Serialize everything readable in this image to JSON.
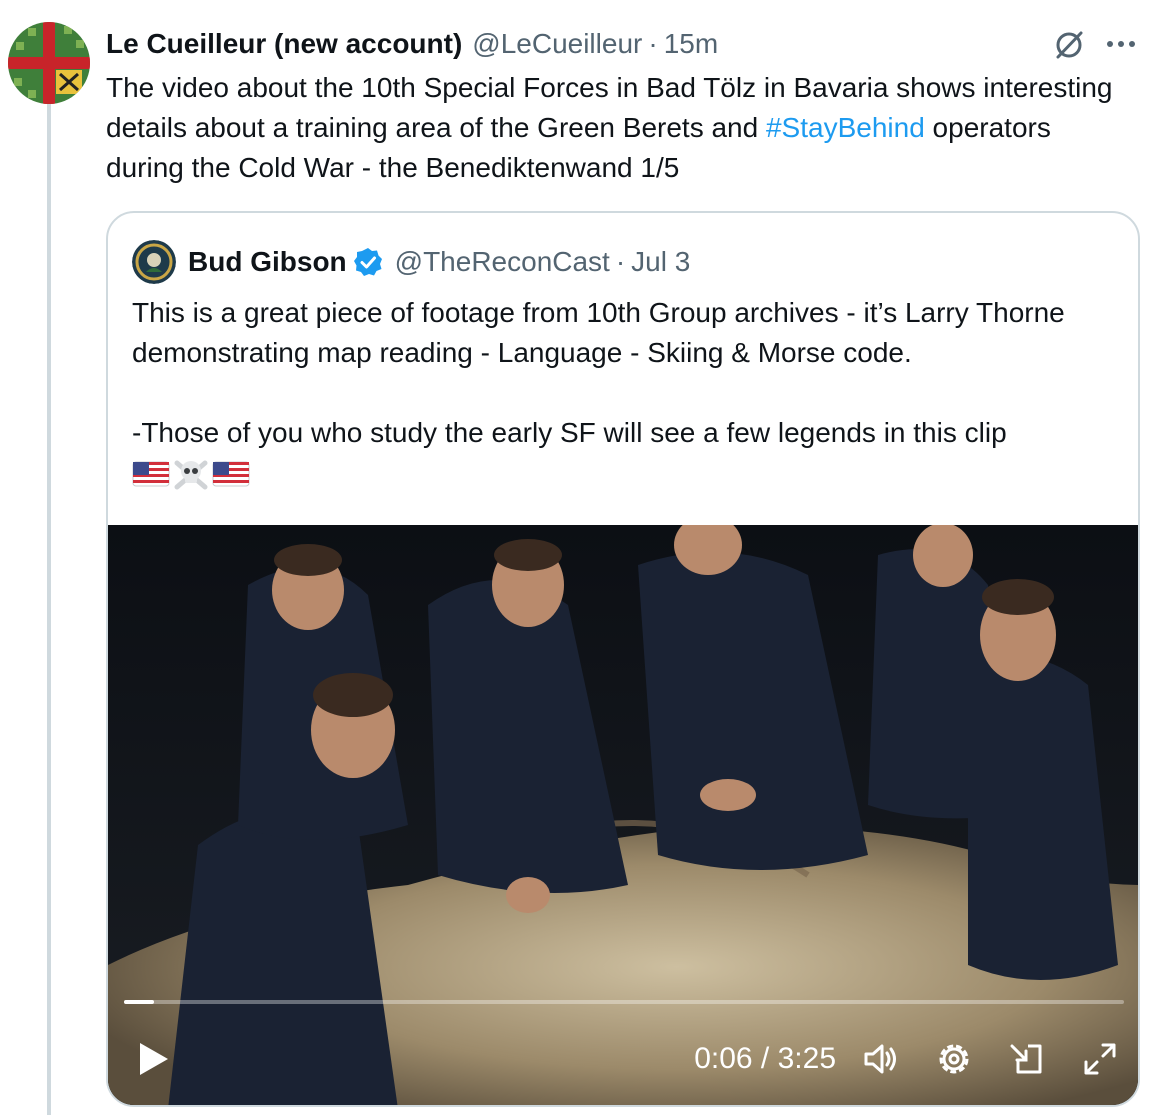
{
  "tweet": {
    "author_name": "Le Cueilleur (new account)",
    "handle": "@LeCueilleur",
    "separator": "·",
    "time": "15m",
    "text_part1": "The video about the 10th Special Forces in Bad Tölz in Bavaria shows interesting details about a training area of the Green Berets and ",
    "hashtag": "#StayBehind",
    "text_part2": " operators during the Cold War - the Benediktenwand 1/5",
    "icons": {
      "grok": "grok-icon",
      "more": "more-icon"
    }
  },
  "quote": {
    "author_name": "Bud Gibson",
    "handle": "@TheReconCast",
    "separator": "·",
    "time": "Jul 3",
    "text": "This is a great piece of footage from 10th Group archives - it’s Larry Thorne demonstrating map reading - Language - Skiing & Morse code.\n\n-Those of you who study the early SF will see a few legends in this clip",
    "emojis": [
      "us-flag",
      "skull-crossbones",
      "us-flag"
    ]
  },
  "video": {
    "current_time": "0:06",
    "duration": "3:25",
    "time_separator": " / ",
    "progress": 0.03,
    "controls": [
      "play-icon",
      "volume-icon",
      "settings-icon",
      "pip-icon",
      "fullscreen-icon"
    ]
  },
  "colors": {
    "accent": "#1d9bf0",
    "secondary_text": "#536471",
    "border": "#cfd9de"
  }
}
